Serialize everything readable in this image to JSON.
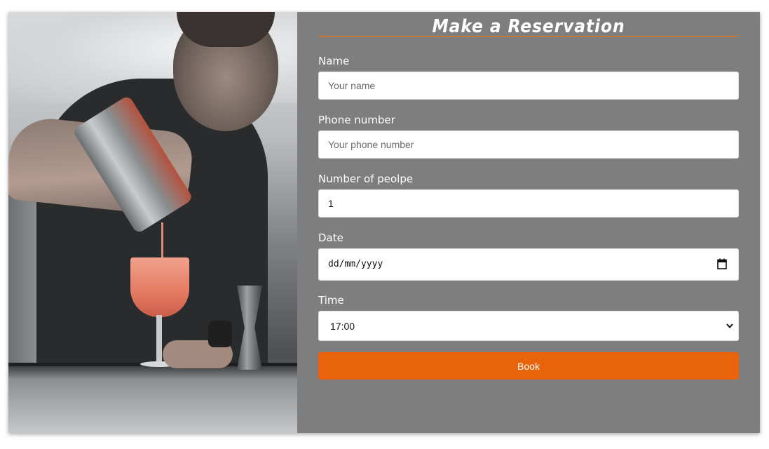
{
  "form": {
    "title": "Make a Reservation",
    "name": {
      "label": "Name",
      "placeholder": "Your name",
      "value": ""
    },
    "phone": {
      "label": "Phone number",
      "placeholder": "Your phone number",
      "value": ""
    },
    "people": {
      "label": "Number of peolpe",
      "value": "1"
    },
    "date": {
      "label": "Date",
      "value": "dd/mm/yyyy"
    },
    "time": {
      "label": "Time",
      "selected": "17:00"
    },
    "book_label": "Book"
  },
  "colors": {
    "panel_bg": "#7e7e7e",
    "accent": "#e8630a",
    "title_rule": "#c8732f"
  },
  "image": {
    "subject": "bartender pouring cocktail photo"
  }
}
